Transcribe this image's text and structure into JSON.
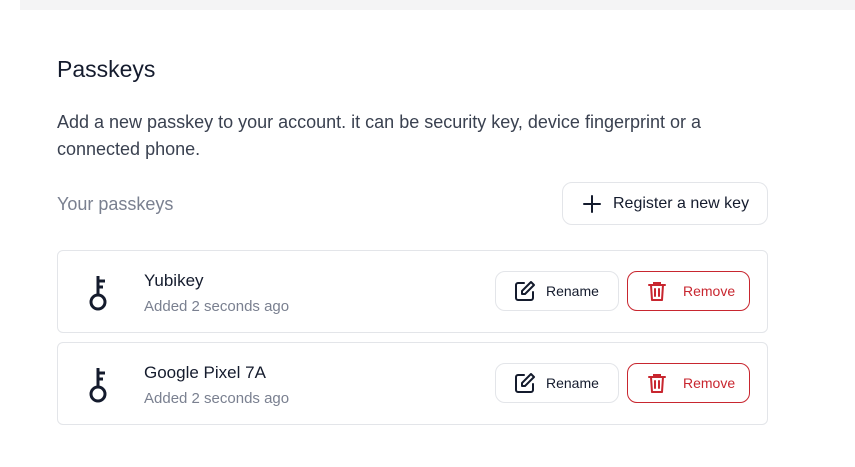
{
  "section": {
    "title": "Passkeys",
    "description": "Add a new passkey to your account. it can be security key, device fingerprint or a connected phone.",
    "subheading": "Your passkeys",
    "register_label": "Register a new key"
  },
  "keys": [
    {
      "name": "Yubikey",
      "added": "Added 2 seconds ago",
      "rename_label": "Rename",
      "remove_label": "Remove"
    },
    {
      "name": "Google Pixel 7A",
      "added": "Added 2 seconds ago",
      "rename_label": "Rename",
      "remove_label": "Remove"
    }
  ],
  "colors": {
    "text": "#141b2d",
    "muted": "#7a8090",
    "danger": "#c8262f",
    "border": "#e3e5e9"
  },
  "icons": [
    "plus-icon",
    "key-icon",
    "edit-icon",
    "trash-icon"
  ]
}
